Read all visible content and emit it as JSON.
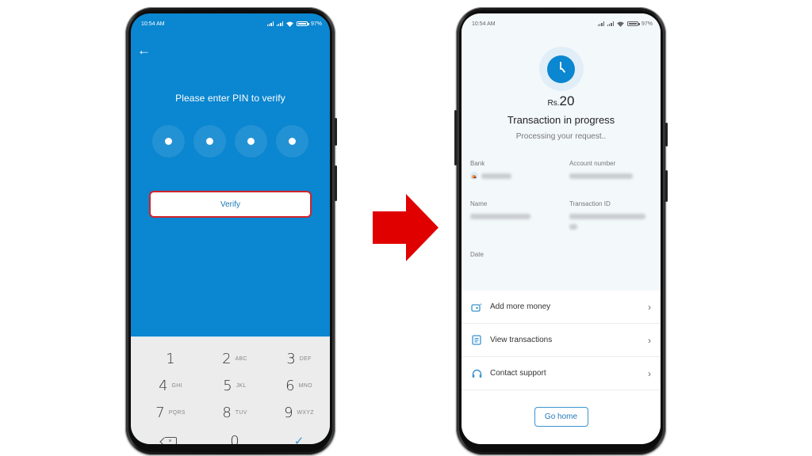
{
  "left_phone": {
    "status_bar": {
      "time": "10:54 AM",
      "battery": "97%"
    },
    "back_icon": "arrow-left-icon",
    "title": "Please enter PIN to verify",
    "pin_length": 4,
    "pin_filled": 4,
    "verify_label": "Verify",
    "keypad": [
      {
        "num": "1",
        "letters": ""
      },
      {
        "num": "2",
        "letters": "ABC"
      },
      {
        "num": "3",
        "letters": "DEF"
      },
      {
        "num": "4",
        "letters": "GHI"
      },
      {
        "num": "5",
        "letters": "JKL"
      },
      {
        "num": "6",
        "letters": "MNO"
      },
      {
        "num": "7",
        "letters": "PQRS"
      },
      {
        "num": "8",
        "letters": "TUV"
      },
      {
        "num": "9",
        "letters": "WXYZ"
      },
      {
        "num": "backspace",
        "letters": ""
      },
      {
        "num": "0",
        "letters": ""
      },
      {
        "num": "✓",
        "letters": ""
      }
    ],
    "colors": {
      "background": "#0b86d0",
      "verify_border": "#d2232a",
      "keypad_bg": "#ececec"
    }
  },
  "right_phone": {
    "status_bar": {
      "time": "10:54 AM",
      "battery": "97%"
    },
    "status_icon": "clock-icon",
    "amount": {
      "currency": "Rs.",
      "value": "20"
    },
    "title": "Transaction in progress",
    "subtitle": "Processing your request..",
    "fields": {
      "bank_label": "Bank",
      "account_label": "Account number",
      "name_label": "Name",
      "txid_label": "Transaction ID",
      "date_label": "Date"
    },
    "actions": [
      {
        "label": "Add more money",
        "icon": "wallet-add-icon"
      },
      {
        "label": "View transactions",
        "icon": "document-list-icon"
      },
      {
        "label": "Contact support",
        "icon": "headset-icon"
      }
    ],
    "go_home_label": "Go home",
    "colors": {
      "accent": "#0b86d0",
      "top_bg": "#f3f8fb"
    }
  },
  "arrow": {
    "color": "#e00000",
    "direction": "right"
  }
}
